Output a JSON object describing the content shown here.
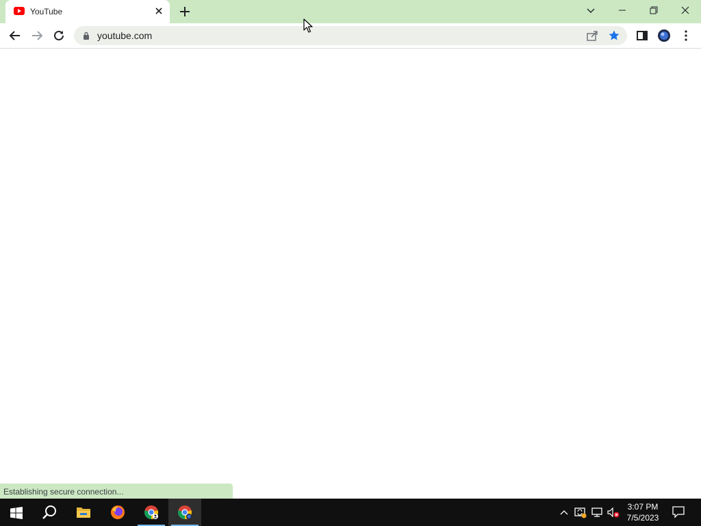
{
  "tab": {
    "title": "YouTube",
    "favicon": "youtube-icon"
  },
  "omnibox": {
    "url": "youtube.com"
  },
  "status": {
    "text": "Establishing secure connection..."
  },
  "taskbar": {
    "apps": [
      "windows-start-icon",
      "search-icon",
      "file-explorer-icon",
      "firefox-icon",
      "chrome-icon",
      "chrome-icon"
    ],
    "time": "3:07 PM",
    "date": "7/5/2023"
  },
  "colors": {
    "titlebar": "#cbe8c3",
    "omnibox": "#edf0ea",
    "accent_star": "#1a73e8",
    "youtube_red": "#ff0000",
    "taskbar": "#101010"
  }
}
